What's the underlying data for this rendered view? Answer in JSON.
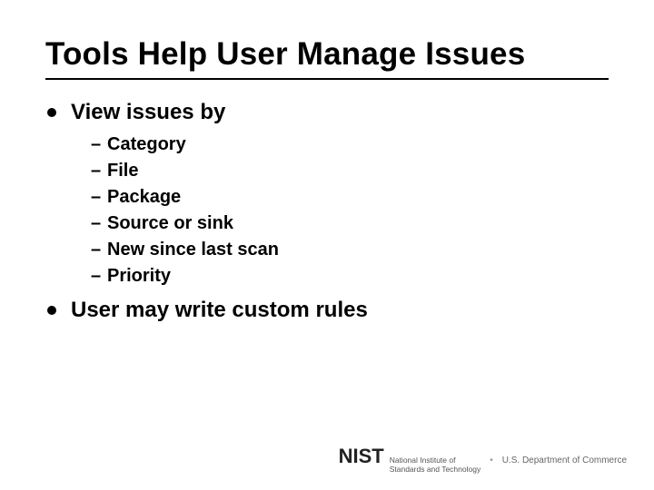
{
  "title": "Tools Help User Manage Issues",
  "bullets": [
    {
      "text": "View issues by",
      "sub": [
        "Category",
        "File",
        "Package",
        "Source or sink",
        "New since last scan",
        "Priority"
      ]
    },
    {
      "text": "User may write custom rules",
      "sub": []
    }
  ],
  "footer": {
    "logo_text": "NIST",
    "logo_sub": "National Institute of\nStandards and Technology",
    "dept": "U.S. Department of Commerce"
  }
}
